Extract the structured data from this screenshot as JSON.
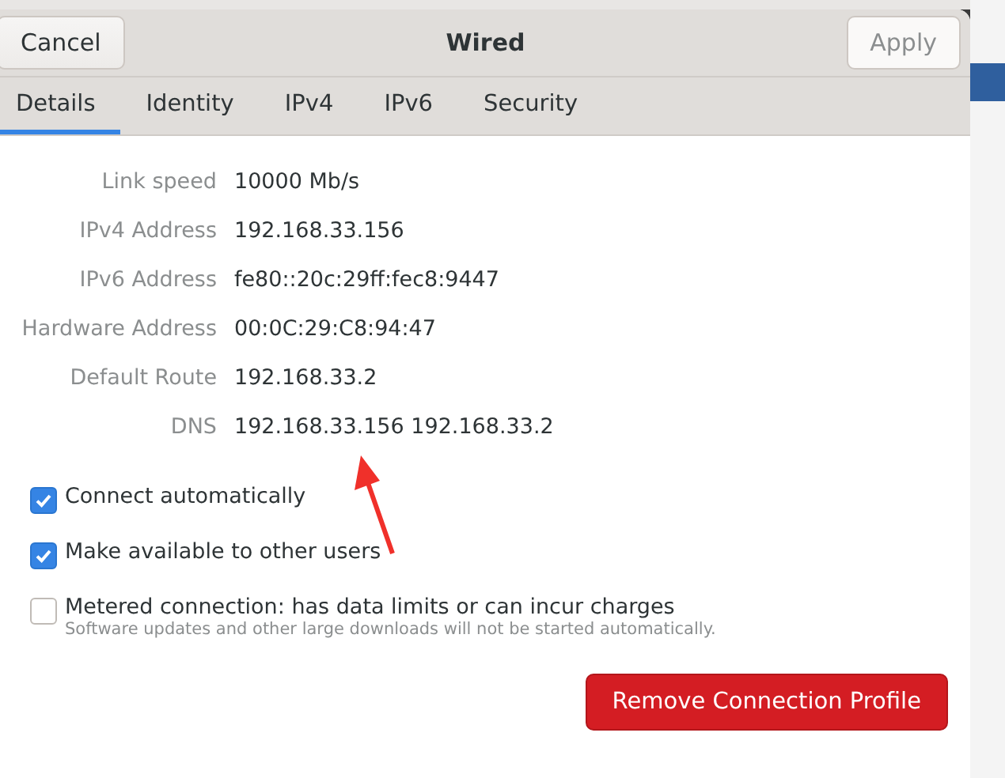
{
  "window": {
    "title": "Wired",
    "cancel_button": "Cancel",
    "apply_button": {
      "label": "Apply",
      "disabled": true
    }
  },
  "tabs": [
    {
      "label": "Details",
      "selected": true
    },
    {
      "label": "Identity",
      "selected": false
    },
    {
      "label": "IPv4",
      "selected": false
    },
    {
      "label": "IPv6",
      "selected": false
    },
    {
      "label": "Security",
      "selected": false
    }
  ],
  "details": [
    {
      "label": "Link speed",
      "value": "10000 Mb/s"
    },
    {
      "label": "IPv4 Address",
      "value": "192.168.33.156"
    },
    {
      "label": "IPv6 Address",
      "value": "fe80::20c:29ff:fec8:9447"
    },
    {
      "label": "Hardware Address",
      "value": "00:0C:29:C8:94:47"
    },
    {
      "label": "Default Route",
      "value": "192.168.33.2"
    },
    {
      "label": "DNS",
      "value": "192.168.33.156 192.168.33.2"
    }
  ],
  "options": [
    {
      "label": "Connect automatically",
      "checked": true
    },
    {
      "label": "Make available to other users",
      "checked": true
    },
    {
      "label": "Metered connection: has data limits or can incur charges",
      "hint": "Software updates and other large downloads will not be started automatically.",
      "checked": false
    }
  ],
  "remove_button": "Remove Connection Profile"
}
